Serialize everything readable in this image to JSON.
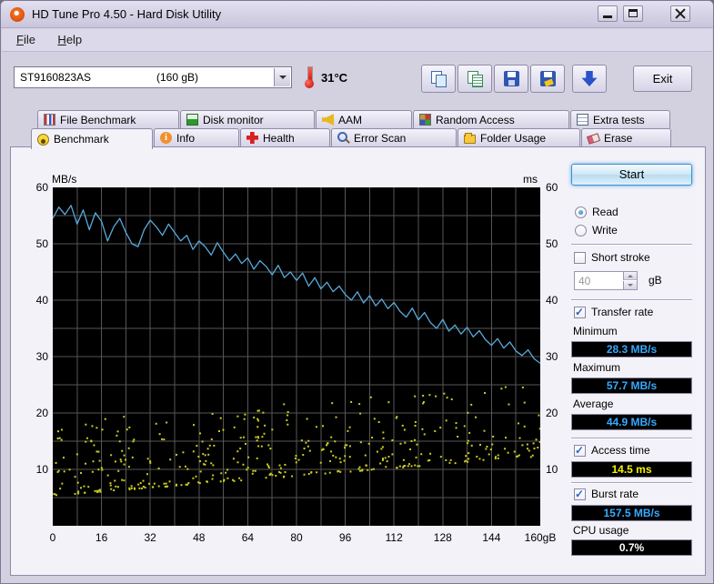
{
  "window": {
    "title": "HD Tune Pro 4.50 - Hard Disk Utility"
  },
  "menu": {
    "items": [
      {
        "label": "File"
      },
      {
        "label": "Help"
      }
    ]
  },
  "toolbar": {
    "drive_select": "ST9160823AS",
    "drive_capacity": "(160 gB)",
    "temperature": "31°C",
    "exit_label": "Exit",
    "icons": [
      "copy-image-icon",
      "copy-text-icon",
      "save-image-icon",
      "save-text-icon",
      "export-down-icon",
      "thermometer-icon"
    ]
  },
  "tabs": {
    "row1": [
      {
        "label": "File Benchmark",
        "icon": "file-benchmark-icon"
      },
      {
        "label": "Disk monitor",
        "icon": "disk-monitor-icon"
      },
      {
        "label": "AAM",
        "icon": "aam-icon"
      },
      {
        "label": "Random Access",
        "icon": "random-access-icon"
      },
      {
        "label": "Extra tests",
        "icon": "extra-tests-icon"
      }
    ],
    "row2": [
      {
        "label": "Benchmark",
        "icon": "benchmark-icon",
        "active": true
      },
      {
        "label": "Info",
        "icon": "info-icon"
      },
      {
        "label": "Health",
        "icon": "health-icon"
      },
      {
        "label": "Error Scan",
        "icon": "error-scan-icon"
      },
      {
        "label": "Folder Usage",
        "icon": "folder-usage-icon"
      },
      {
        "label": "Erase",
        "icon": "erase-icon"
      }
    ]
  },
  "panel": {
    "start_label": "Start",
    "read_label": "Read",
    "read_selected": true,
    "write_label": "Write",
    "write_selected": false,
    "short_stroke_label": "Short stroke",
    "short_stroke_checked": false,
    "short_stroke_value": "40",
    "short_stroke_unit": "gB",
    "transfer_rate_label": "Transfer rate",
    "transfer_rate_checked": true,
    "minimum_label": "Minimum",
    "minimum_value": "28.3 MB/s",
    "maximum_label": "Maximum",
    "maximum_value": "57.7 MB/s",
    "average_label": "Average",
    "average_value": "44.9 MB/s",
    "access_time_label": "Access time",
    "access_time_checked": true,
    "access_time_value": "14.5 ms",
    "burst_rate_label": "Burst rate",
    "burst_rate_checked": true,
    "burst_rate_value": "157.5 MB/s",
    "cpu_usage_label": "CPU usage",
    "cpu_usage_value": "0.7%"
  },
  "chart_data": {
    "type": "line+scatter",
    "left_unit": "MB/s",
    "right_unit": "ms",
    "xlim": [
      0,
      160
    ],
    "ylim": [
      0,
      60
    ],
    "x_ticks": [
      0,
      16,
      32,
      48,
      64,
      80,
      96,
      112,
      128,
      144,
      160
    ],
    "x_last_suffix": "gB",
    "y_ticks": [
      10,
      20,
      30,
      40,
      50,
      60
    ],
    "grid_x_step_gb": 8,
    "grid_y_step": 5,
    "grid_color": "#565656",
    "background": "#000000",
    "transfer_rate": {
      "name": "Transfer rate (MB/s)",
      "color": "#58aadc",
      "step_gb": 2,
      "values": [
        54.5,
        56.5,
        55.2,
        56.8,
        53.5,
        56.0,
        52.5,
        55.5,
        54.0,
        50.5,
        53.0,
        54.5,
        52.0,
        50.0,
        49.5,
        52.5,
        54.2,
        53.0,
        51.5,
        53.5,
        52.0,
        50.5,
        51.5,
        49.0,
        50.5,
        49.5,
        48.0,
        50.2,
        48.5,
        47.0,
        48.2,
        46.5,
        47.5,
        45.5,
        47.0,
        46.0,
        44.5,
        46.2,
        44.0,
        45.0,
        43.5,
        44.8,
        42.5,
        44.0,
        42.0,
        43.2,
        41.5,
        42.5,
        41.0,
        40.0,
        41.5,
        39.5,
        40.8,
        39.0,
        40.2,
        38.5,
        39.6,
        38.0,
        37.0,
        38.6,
        36.5,
        37.8,
        36.0,
        35.0,
        36.6,
        34.5,
        35.6,
        34.0,
        35.2,
        33.5,
        34.6,
        33.0,
        32.0,
        33.2,
        31.5,
        32.6,
        31.0,
        30.2,
        31.2,
        29.6,
        28.8
      ],
      "minimum": 28.3,
      "maximum": 57.7,
      "average": 44.9
    },
    "access_time": {
      "name": "Access time (ms)",
      "color": "#cccc22",
      "count": 430,
      "seed": 11,
      "y_base_left": 5.5,
      "y_base_right": 12.5,
      "spread": 13,
      "average_ms": 14.5
    }
  }
}
